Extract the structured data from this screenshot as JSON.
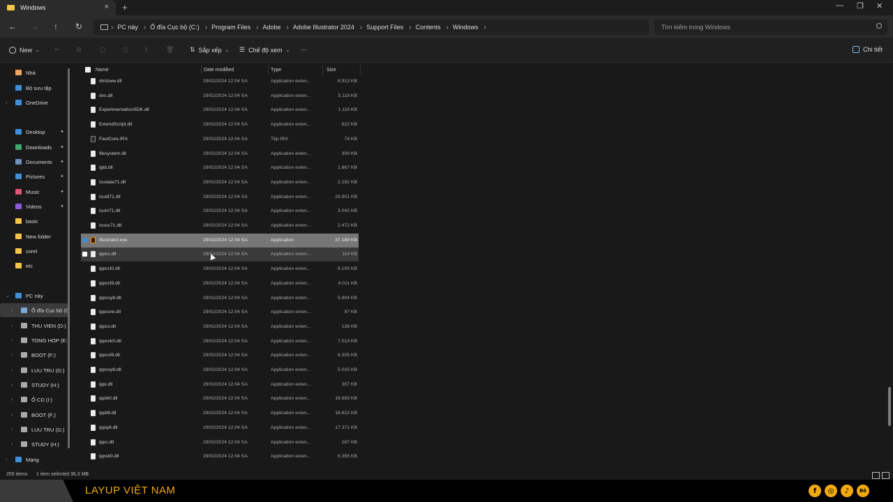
{
  "window": {
    "tab_title": "Windows",
    "minimize": "—",
    "maximize": "❐",
    "close": "✕"
  },
  "address": {
    "crumbs": [
      "PC này",
      "Ổ đĩa Cục bộ (C:)",
      "Program Files",
      "Adobe",
      "Adobe Illustrator 2024",
      "Support Files",
      "Contents",
      "Windows"
    ],
    "search_placeholder": "Tìm kiếm trong Windows"
  },
  "toolbar": {
    "new_label": "New",
    "sort_label": "Sắp xếp",
    "view_label": "Chế độ xem",
    "more_label": "···",
    "details_label": "Chi tiết"
  },
  "sidebar": {
    "items": [
      {
        "label": "Nhà",
        "icon": "home-icon",
        "color": "#f0a35e"
      },
      {
        "label": "Bộ sưu tập",
        "icon": "gallery-icon",
        "color": "#3f8fd8"
      },
      {
        "label": "OneDrive",
        "icon": "cloud-icon",
        "color": "#3f8fd8"
      },
      {
        "label": "Desktop",
        "icon": "desktop-icon",
        "color": "#3f8fd8"
      },
      {
        "label": "Downloads",
        "icon": "download-icon",
        "color": "#3fa86e"
      },
      {
        "label": "Documents",
        "icon": "documents-icon",
        "color": "#6e8fb8"
      },
      {
        "label": "Pictures",
        "icon": "pictures-icon",
        "color": "#3f8fd8"
      },
      {
        "label": "Music",
        "icon": "music-icon",
        "color": "#e0557a"
      },
      {
        "label": "Videos",
        "icon": "videos-icon",
        "color": "#8a5cd8"
      },
      {
        "label": "basic",
        "icon": "folder-icon",
        "color": "#f2c54a"
      },
      {
        "label": "New folder",
        "icon": "folder-icon",
        "color": "#f2c54a"
      },
      {
        "label": "corel",
        "icon": "folder-icon",
        "color": "#f2c54a"
      },
      {
        "label": "etc",
        "icon": "folder-icon",
        "color": "#f2c54a"
      },
      {
        "label": "PC này",
        "icon": "pc-icon",
        "color": "#3f8fd8"
      },
      {
        "label": "Ổ đĩa Cục bộ (C:)",
        "icon": "drive-icon",
        "color": "#7aa8d8"
      },
      {
        "label": "THU VIEN (D:)",
        "icon": "drive-icon",
        "color": "#aaaaaa"
      },
      {
        "label": "TONG HOP (E:)",
        "icon": "drive-icon",
        "color": "#aaaaaa"
      },
      {
        "label": "BOOT (F:)",
        "icon": "drive-icon",
        "color": "#aaaaaa"
      },
      {
        "label": "LUU TRU (G:)",
        "icon": "drive-icon",
        "color": "#aaaaaa"
      },
      {
        "label": "STUDY (H:)",
        "icon": "drive-icon",
        "color": "#aaaaaa"
      },
      {
        "label": "Ổ CD (I:)",
        "icon": "cd-icon",
        "color": "#aaaaaa"
      },
      {
        "label": "BOOT (F:)",
        "icon": "drive-icon",
        "color": "#aaaaaa"
      },
      {
        "label": "LUU TRU (G:)",
        "icon": "drive-icon",
        "color": "#aaaaaa"
      },
      {
        "label": "STUDY (H:)",
        "icon": "drive-icon",
        "color": "#aaaaaa"
      },
      {
        "label": "Mạng",
        "icon": "network-icon",
        "color": "#3f8fd8"
      }
    ]
  },
  "columns": {
    "name": "Name",
    "date": "Date modified",
    "type": "Type",
    "size": "Size"
  },
  "files": [
    {
      "name": "dmlzww.dll",
      "date": "29/02/2024 12:04 SA",
      "type": "Application exten...",
      "size": "8.913 KB"
    },
    {
      "name": "dvs.dll",
      "date": "29/02/2024 12:04 SA",
      "type": "Application exten...",
      "size": "5.118 KB"
    },
    {
      "name": "ExperimentationSDK.dll",
      "date": "29/02/2024 12:04 SA",
      "type": "Application exten...",
      "size": "1.118 KB"
    },
    {
      "name": "ExtendScript.dll",
      "date": "29/02/2024 12:04 SA",
      "type": "Application exten...",
      "size": "622 KB"
    },
    {
      "name": "FastCore.IRX",
      "date": "29/02/2024 12:04 SA",
      "type": "Tệp IRX",
      "size": "74 KB"
    },
    {
      "name": "filesystem.dll",
      "date": "29/02/2024 12:04 SA",
      "type": "Application exten...",
      "size": "309 KB"
    },
    {
      "name": "igtd.dll",
      "date": "29/02/2024 12:04 SA",
      "type": "Application exten...",
      "size": "1.867 KB"
    },
    {
      "name": "icudata71.dll",
      "date": "29/02/2024 12:04 SA",
      "type": "Application exten...",
      "size": "2.292 KB"
    },
    {
      "name": "icudt71.dll",
      "date": "29/02/2024 12:04 SA",
      "type": "Application exten...",
      "size": "29.901 KB"
    },
    {
      "name": "icuin71.dll",
      "date": "29/02/2024 12:04 SA",
      "type": "Application exten...",
      "size": "3.042 KB"
    },
    {
      "name": "icuuc71.dll",
      "date": "29/02/2024 12:04 SA",
      "type": "Application exten...",
      "size": "2.472 KB"
    },
    {
      "name": "Illustrator.exe",
      "date": "29/02/2024 12:04 SA",
      "type": "Application",
      "size": "37.189 KB",
      "state": "sel",
      "icon": "ai"
    },
    {
      "name": "ippcc.dll",
      "date": "29/02/2024 12:04 SA",
      "type": "Application exten...",
      "size": "114 KB",
      "state": "hov"
    },
    {
      "name": "ippccl0.dll",
      "date": "29/02/2024 12:04 SA",
      "type": "Application exten...",
      "size": "6.105 KB"
    },
    {
      "name": "ippccl9.dll",
      "date": "29/02/2024 12:04 SA",
      "type": "Application exten...",
      "size": "4.011 KB"
    },
    {
      "name": "ippccy8.dll",
      "date": "29/02/2024 12:04 SA",
      "type": "Application exten...",
      "size": "5.904 KB"
    },
    {
      "name": "ippcore.dll",
      "date": "29/02/2024 12:04 SA",
      "type": "Application exten...",
      "size": "97 KB"
    },
    {
      "name": "ippcv.dll",
      "date": "29/02/2024 12:04 SA",
      "type": "Application exten...",
      "size": "138 KB"
    },
    {
      "name": "ippcvk0.dll",
      "date": "29/02/2024 12:04 SA",
      "type": "Application exten...",
      "size": "7.013 KB"
    },
    {
      "name": "ippcvl9.dll",
      "date": "29/02/2024 12:04 SA",
      "type": "Application exten...",
      "size": "6.305 KB"
    },
    {
      "name": "ippcvy8.dll",
      "date": "29/02/2024 12:04 SA",
      "type": "Application exten...",
      "size": "5.015 KB"
    },
    {
      "name": "ippi.dll",
      "date": "29/02/2024 12:04 SA",
      "type": "Application exten...",
      "size": "307 KB"
    },
    {
      "name": "ippik0.dll",
      "date": "29/02/2024 12:04 SA",
      "type": "Application exten...",
      "size": "16.893 KB"
    },
    {
      "name": "ippil9.dll",
      "date": "29/02/2024 12:04 SA",
      "type": "Application exten...",
      "size": "18.622 KB"
    },
    {
      "name": "ippiy8.dll",
      "date": "29/02/2024 12:04 SA",
      "type": "Application exten...",
      "size": "17.371 KB"
    },
    {
      "name": "ipps.dll",
      "date": "29/02/2024 12:04 SA",
      "type": "Application exten...",
      "size": "167 KB"
    },
    {
      "name": "ippsk0.dll",
      "date": "29/02/2024 12:04 SA",
      "type": "Application exten...",
      "size": "6.355 KB"
    }
  ],
  "status": {
    "count": "255 items",
    "selection": "1 item selected 36,3 MB"
  },
  "brand": {
    "name": "LAYUP VIỆT NAM",
    "accent": "#f1a90f",
    "socials": [
      "f",
      "◎",
      "♪",
      "Bē"
    ]
  }
}
